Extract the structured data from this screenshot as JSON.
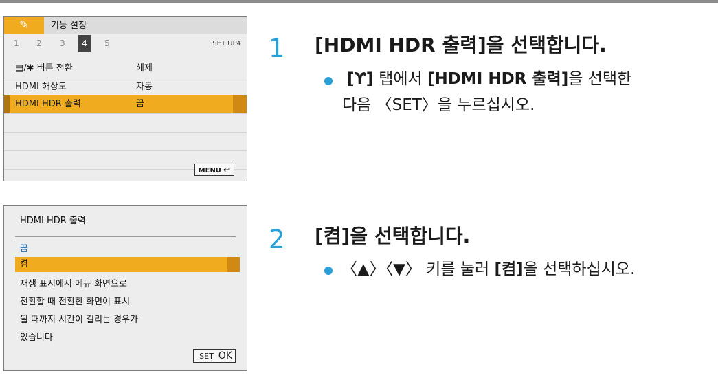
{
  "screen1": {
    "tab_icon": "wrench-icon",
    "tab_icon_glyph": "✎",
    "tab_name": "기능 설정",
    "tab_numbers": [
      "1",
      "2",
      "3",
      "4",
      "5"
    ],
    "active_tab": "4",
    "tab_code": "SET UP4",
    "rows": [
      {
        "label": "▤/✱ 버튼 전환",
        "value": "해제"
      },
      {
        "label": "HDMI 해상도",
        "value": "자동"
      },
      {
        "label": "HDMI HDR 출력",
        "value": "끔"
      }
    ],
    "menu_button": "MENU",
    "menu_return_glyph": "↩"
  },
  "screen2": {
    "title": "HDMI HDR 출력",
    "options": [
      "끔",
      "켬"
    ],
    "description_lines": [
      "재생 표시에서 메뉴 화면으로",
      "전환할 때 전환한 화면이 표시",
      "될 때까지 시간이 걸리는 경우가",
      "있습니다"
    ],
    "set_label": "SET",
    "ok_label": "OK"
  },
  "step1": {
    "number": "1",
    "title": "[HDMI HDR 출력]을 선택합니다.",
    "text_p1": "[",
    "text_icon": "ϒ",
    "text_p2": "] ",
    "text_p3": "탭에서 ",
    "text_p4": "[HDMI HDR 출력]",
    "text_p5": "을 선택한",
    "text_line2": "다음 〈SET〉을 누르십시오."
  },
  "step2": {
    "number": "2",
    "title": "[켬]을 선택합니다.",
    "text_p1": "〈▲〉〈▼〉 키를 눌러 ",
    "text_p2": "[켬]",
    "text_p3": "을 선택하십시오."
  },
  "colors": {
    "accent_orange": "#f0ab1e",
    "step_blue": "#2a9fd8",
    "current_option_blue": "#1e73be"
  }
}
